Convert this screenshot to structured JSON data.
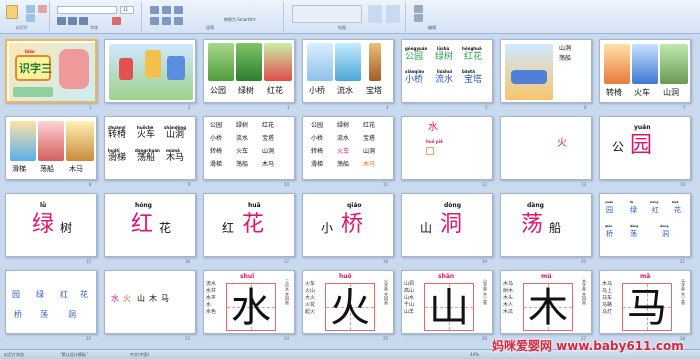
{
  "ribbon": {
    "groups": [
      "幻灯片",
      "字体",
      "段落",
      "绘图",
      "编辑"
    ],
    "font_size": "11",
    "convert_label": "转换为 SmartArt"
  },
  "slides": [
    {
      "n": "1",
      "title": "识字三",
      "subtitle": "biǎo",
      "label": "学习"
    },
    {
      "n": "2"
    },
    {
      "n": "3",
      "words": [
        "公园",
        "绿树",
        "红花"
      ]
    },
    {
      "n": "4",
      "words": [
        "小桥",
        "流水",
        "宝塔"
      ]
    },
    {
      "n": "5",
      "row1_pinyin": [
        "gōngyuán",
        "lǜshù",
        "hónghuā"
      ],
      "row1": [
        "公园",
        "绿树",
        "红花"
      ],
      "row2_pinyin": [
        "xiǎoqiáo",
        "liúshuǐ",
        "bǎotǎ"
      ],
      "row2": [
        "小桥",
        "流水",
        "宝塔"
      ]
    },
    {
      "n": "6",
      "words": [
        "山洞",
        "荡船"
      ]
    },
    {
      "n": "7",
      "words": [
        "转椅",
        "火车",
        "山洞"
      ]
    },
    {
      "n": "8",
      "words": [
        "滑梯",
        "荡船",
        "木马"
      ]
    },
    {
      "n": "9",
      "row1_pinyin": [
        "zhuànyǐ",
        "huǒchē",
        "shāndòng"
      ],
      "row1": [
        "转椅",
        "火车",
        "山洞"
      ],
      "row2_pinyin": [
        "huátī",
        "dàngchuán",
        "mùmǎ"
      ],
      "row2": [
        "滑梯",
        "荡船",
        "木马"
      ]
    },
    {
      "n": "10",
      "rows": [
        [
          "公园",
          "绿树",
          "红花"
        ],
        [
          "小桥",
          "流水",
          "宝塔"
        ],
        [
          "转椅",
          "火车",
          "山洞"
        ],
        [
          "滑梯",
          "荡船",
          "木马"
        ]
      ]
    },
    {
      "n": "11",
      "rows": [
        [
          "公园",
          "绿树",
          "红花"
        ],
        [
          "小桥",
          "流水",
          "宝塔"
        ],
        [
          "转椅",
          "火车",
          "山洞"
        ],
        [
          "滑梯",
          "荡船",
          "木马"
        ]
      ]
    },
    {
      "n": "12",
      "char": "水",
      "pinyin": "huǒ piě"
    },
    {
      "n": "13",
      "char": "火"
    },
    {
      "n": "14",
      "pinyin": "yuán",
      "prefix": "公",
      "char": "园"
    },
    {
      "n": "15",
      "pinyin": "lǜ",
      "char": "绿",
      "suffix": "树"
    },
    {
      "n": "16",
      "pinyin": "hóng",
      "char": "红",
      "suffix": "花"
    },
    {
      "n": "17",
      "pinyin": "huā",
      "prefix": "红",
      "char": "花"
    },
    {
      "n": "18",
      "pinyin": "qiáo",
      "prefix": "小",
      "char": "桥"
    },
    {
      "n": "19",
      "pinyin": "dòng",
      "prefix": "山",
      "char": "洞"
    },
    {
      "n": "20",
      "pinyin": "dàng",
      "char": "荡",
      "suffix": "船"
    },
    {
      "n": "21",
      "top_pinyin": [
        "yuán",
        "lǜ",
        "hóng",
        "huā"
      ],
      "top": [
        "园",
        "绿",
        "红",
        "花"
      ],
      "bottom_pinyin": [
        "qiáo",
        "dàng",
        "dòng"
      ],
      "bottom": [
        "桥",
        "荡",
        "洞"
      ]
    },
    {
      "n": "22",
      "top": [
        "园",
        "绿",
        "红",
        "花"
      ],
      "bottom": [
        "桥",
        "荡",
        "洞"
      ]
    },
    {
      "n": "23",
      "chars": [
        "水",
        "火",
        "山",
        "木",
        "马"
      ]
    },
    {
      "n": "24",
      "pinyin": "shuǐ",
      "char": "水",
      "side": [
        "流水",
        "水井",
        "水平",
        "水",
        "水色"
      ],
      "note": "三点水 共四画"
    },
    {
      "n": "25",
      "pinyin": "huǒ",
      "char": "火",
      "side": [
        "火车",
        "火山",
        "大火",
        "火花",
        "起火"
      ],
      "note": "火字旁 共四画"
    },
    {
      "n": "26",
      "pinyin": "shān",
      "char": "山",
      "side": [
        "山洞",
        "高山",
        "山水",
        "千山",
        "山羊"
      ],
      "note": "山字旁 共三画"
    },
    {
      "n": "27",
      "pinyin": "mù",
      "char": "木",
      "side": [
        "木马",
        "树木",
        "木头",
        "木人",
        "木瓜"
      ],
      "note": "木字旁 共四画"
    },
    {
      "n": "28",
      "pinyin": "mǎ",
      "char": "马",
      "side": [
        "木马",
        "马上",
        "马车",
        "马路",
        "马灯"
      ],
      "note": "马字旁 共三画"
    }
  ],
  "status": {
    "left": "幻灯片浏览",
    "theme": "\"默认设计模板\"",
    "lang": "中文(中国)",
    "zoom": "44%"
  },
  "watermark": "妈咪爱婴网 www.baby611.com"
}
